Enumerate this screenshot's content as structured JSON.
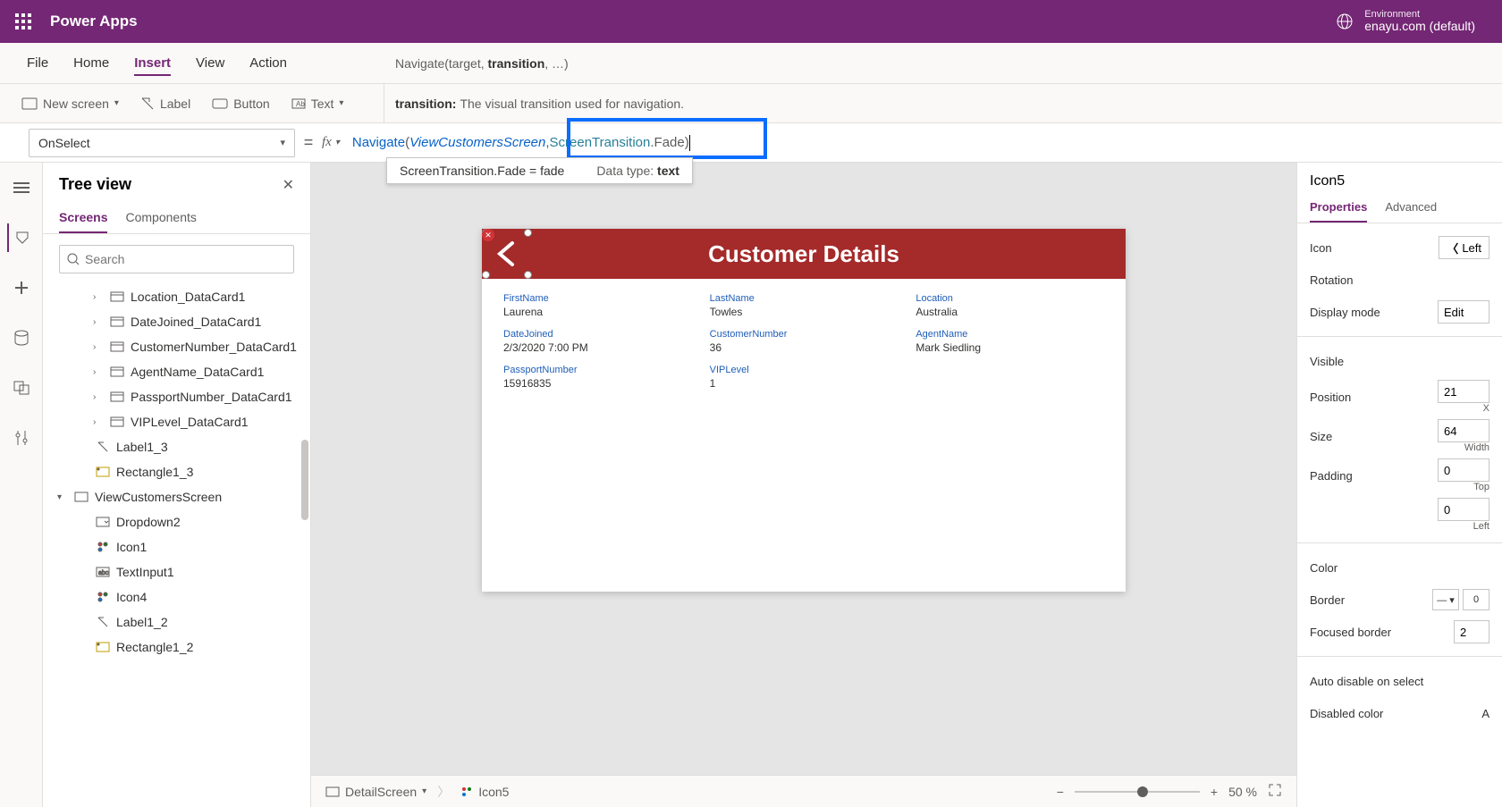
{
  "titlebar": {
    "app": "Power Apps",
    "env_label": "Environment",
    "env_name": "enayu.com (default)"
  },
  "menu": {
    "file": "File",
    "home": "Home",
    "insert": "Insert",
    "view": "View",
    "action": "Action"
  },
  "tooltip_sig_pre": "Navigate(target, ",
  "tooltip_sig_bold": "transition",
  "tooltip_sig_post": ", …)",
  "hint_label": "transition:",
  "hint_text": "The visual transition used for navigation.",
  "ribbon": {
    "newscreen": "New screen",
    "label": "Label",
    "button": "Button",
    "text": "Text"
  },
  "prop_selector": "OnSelect",
  "formula": {
    "fn": "Navigate",
    "arg1": "ViewCustomersScreen",
    "arg2a": "ScreenTransition",
    "arg2b": ".Fade"
  },
  "autocomplete": {
    "left": "ScreenTransition.Fade  =  fade",
    "right_label": "Data type:",
    "right_val": "text"
  },
  "tree": {
    "title": "Tree view",
    "tab_screens": "Screens",
    "tab_components": "Components",
    "search_ph": "Search",
    "items": [
      {
        "indent": 2,
        "chev": true,
        "icon": "card",
        "label": "Location_DataCard1"
      },
      {
        "indent": 2,
        "chev": true,
        "icon": "card",
        "label": "DateJoined_DataCard1"
      },
      {
        "indent": 2,
        "chev": true,
        "icon": "card",
        "label": "CustomerNumber_DataCard1"
      },
      {
        "indent": 2,
        "chev": true,
        "icon": "card",
        "label": "AgentName_DataCard1"
      },
      {
        "indent": 2,
        "chev": true,
        "icon": "card",
        "label": "PassportNumber_DataCard1"
      },
      {
        "indent": 2,
        "chev": true,
        "icon": "card",
        "label": "VIPLevel_DataCard1"
      },
      {
        "indent": 1,
        "chev": false,
        "icon": "label",
        "label": "Label1_3"
      },
      {
        "indent": 1,
        "chev": false,
        "icon": "rect",
        "label": "Rectangle1_3"
      },
      {
        "indent": 0,
        "chev": true,
        "open": true,
        "icon": "screen",
        "label": "ViewCustomersScreen"
      },
      {
        "indent": 1,
        "chev": false,
        "icon": "dropdown",
        "label": "Dropdown2"
      },
      {
        "indent": 1,
        "chev": false,
        "icon": "icon",
        "label": "Icon1"
      },
      {
        "indent": 1,
        "chev": false,
        "icon": "textinput",
        "label": "TextInput1"
      },
      {
        "indent": 1,
        "chev": false,
        "icon": "icon",
        "label": "Icon4"
      },
      {
        "indent": 1,
        "chev": false,
        "icon": "label",
        "label": "Label1_2"
      },
      {
        "indent": 1,
        "chev": false,
        "icon": "rect",
        "label": "Rectangle1_2"
      }
    ]
  },
  "canvas": {
    "header": "Customer Details",
    "fields": [
      {
        "label": "FirstName",
        "value": "Laurena"
      },
      {
        "label": "LastName",
        "value": "Towles"
      },
      {
        "label": "Location",
        "value": "Australia"
      },
      {
        "label": "DateJoined",
        "value": "2/3/2020 7:00 PM"
      },
      {
        "label": "CustomerNumber",
        "value": "36"
      },
      {
        "label": "AgentName",
        "value": "Mark Siedling"
      },
      {
        "label": "PassportNumber",
        "value": "15916835"
      },
      {
        "label": "VIPLevel",
        "value": "1"
      }
    ]
  },
  "footer": {
    "bc1": "DetailScreen",
    "bc2": "Icon5",
    "zoom": "50",
    "pct": "%"
  },
  "props": {
    "selected": "Icon5",
    "tab_props": "Properties",
    "tab_adv": "Advanced",
    "icon_label": "Icon",
    "icon_val": "Left",
    "rotation": "Rotation",
    "display_mode": "Display mode",
    "display_mode_val": "Edit",
    "visible": "Visible",
    "position": "Position",
    "pos_x": "21",
    "pos_x_lbl": "X",
    "size": "Size",
    "size_w": "64",
    "size_w_lbl": "Width",
    "padding": "Padding",
    "pad_t": "0",
    "pad_t_lbl": "Top",
    "pad_l": "0",
    "pad_l_lbl": "Left",
    "color": "Color",
    "border": "Border",
    "border_val": "0",
    "focused": "Focused border",
    "focused_val": "2",
    "auto_disable": "Auto disable on select",
    "disabled_color": "Disabled color",
    "disabled_color_val": "A"
  }
}
